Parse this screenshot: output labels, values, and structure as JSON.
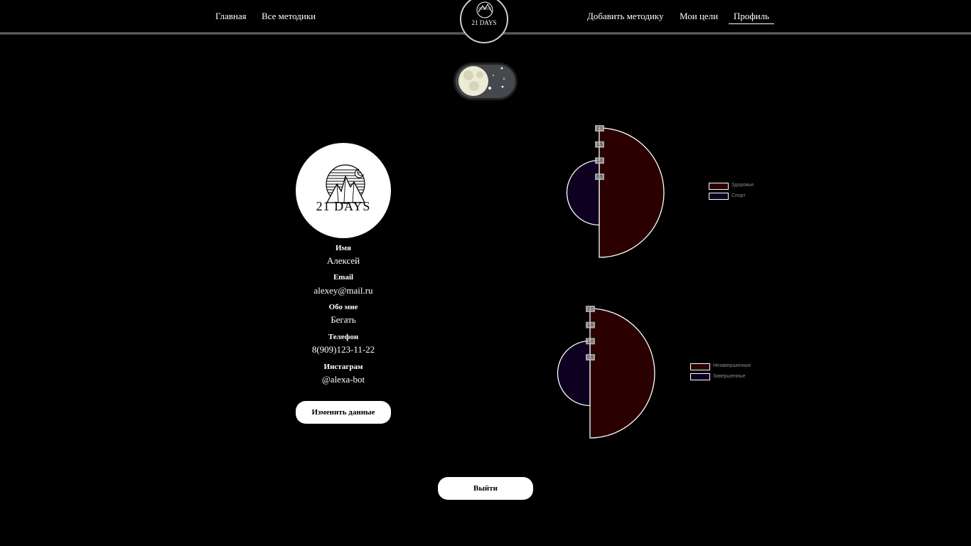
{
  "nav": {
    "left": [
      {
        "label": "Главная"
      },
      {
        "label": "Все методики"
      }
    ],
    "right": [
      {
        "label": "Добавить методику"
      },
      {
        "label": "Мои цели"
      },
      {
        "label": "Профиль"
      }
    ],
    "logo_text": "21 DAYS"
  },
  "avatar_logo_text": "21 DAYS",
  "profile": {
    "name_label": "Имя",
    "name": "Алексей",
    "email_label": "Email",
    "email": "alexey@mail.ru",
    "about_label": "Обо мне",
    "about": "Бегать",
    "phone_label": "Телефон",
    "phone": "8(909)123-11-22",
    "instagram_label": "Инстаграм",
    "instagram": "@alexa-bot",
    "edit_button": "Изменить данные"
  },
  "logout_button": "Выйти",
  "theme_toggle_state": "night",
  "colors": {
    "dark_red": "#2a0000",
    "dark_blue": "#0e0020",
    "stroke": "#ffffff",
    "background": "#000000"
  },
  "chart_data": [
    {
      "type": "pie",
      "series": [
        {
          "name": "Здоровье",
          "value": 2,
          "color": "#2a0000"
        },
        {
          "name": "Спорт",
          "value": 1,
          "color": "#0e0020"
        }
      ],
      "tick_labels": [
        "2.0",
        "1.5",
        "1.0",
        "0.5"
      ],
      "legend_position": "right"
    },
    {
      "type": "pie",
      "series": [
        {
          "name": "Незавершенные",
          "value": 2,
          "color": "#2a0000"
        },
        {
          "name": "Завершенные",
          "value": 1,
          "color": "#0e0020"
        }
      ],
      "tick_labels": [
        "2.0",
        "1.5",
        "1.0",
        "0.5"
      ],
      "legend_position": "right"
    }
  ]
}
